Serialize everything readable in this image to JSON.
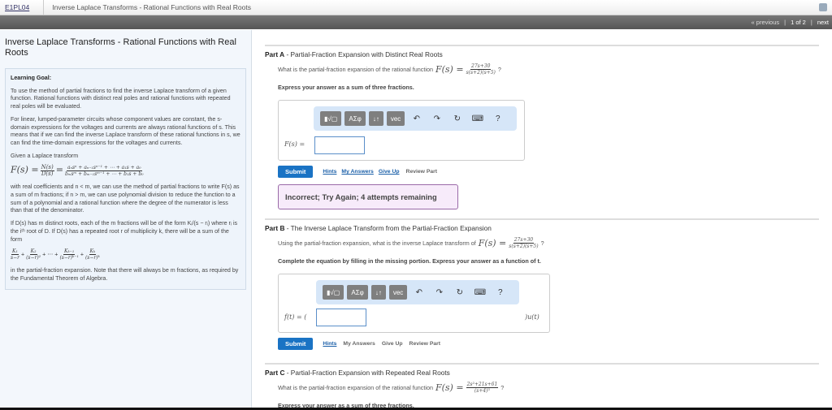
{
  "breadcrumb": {
    "code": "E1PL04",
    "title": "Inverse Laplace Transforms - Rational Functions with Real Roots"
  },
  "nav": {
    "previous": "« previous",
    "page": "1 of 2",
    "next": "next"
  },
  "left": {
    "title": "Inverse Laplace Transforms - Rational Functions with Real Roots",
    "goal_label": "Learning Goal:",
    "p1": "To use the method of partial fractions to find the inverse Laplace transform of a given function. Rational functions with distinct real poles and rational functions with repeated real poles will be evaluated.",
    "p2": "For linear, lumped-parameter circuits whose component values are constant, the s-domain expressions for the voltages and currents are always rational functions of s. This means that if we can find the inverse Laplace transform of these rational functions in s, we can find the time-domain expressions for the voltages and currents.",
    "p3": "Given a Laplace transform",
    "eq1": {
      "lhs": "F(s) =",
      "n": "N(s)",
      "d": "D(s)",
      "eq": "=",
      "num": "aₙsⁿ + aₙ₋₁sⁿ⁻¹ + ⋯ + a₁s + a₀",
      "den": "bₘsᵐ + bₘ₋₁sᵐ⁻¹ + ⋯ + b₁s + b₀"
    },
    "p4": "with real coefficients and n < m, we can use the method of partial fractions to write F(s) as a sum of m fractions; if n > m, we can use polynomial division to reduce the function to a sum of a polynomial and a rational function where the degree of the numerator is less than that of the denominator.",
    "p5": "If D(s) has m distinct roots, each of the m fractions will be of the form Kᵢ/(s − rᵢ) where rᵢ is the iᵗʰ root of D. If D(s) has a repeated root r of multiplicity k, there will be a sum of the form",
    "eq2": [
      {
        "n": "K₁",
        "d": "s−r"
      },
      {
        "n": "K₂",
        "d": "(s−r)²"
      },
      {
        "n": "Kₖ₋₁",
        "d": "(s−r)ᵏ⁻¹"
      },
      {
        "n": "Kₖ",
        "d": "(s−r)ᵏ"
      }
    ],
    "eq2_dots": "+ ⋯ +",
    "p6": "in the partial-fraction expansion. Note that there will always be m fractions, as required by the Fundamental Theorem of Algebra."
  },
  "toolbar": {
    "templates": "▮√▢",
    "greek": "ΑΣφ",
    "arrows": "↓↑",
    "vec": "vec",
    "undo": "↶",
    "redo": "↷",
    "reset": "↻",
    "keyboard": "⌨",
    "help": "?"
  },
  "partA": {
    "label": "Part A",
    "title": " - Partial-Fraction Expansion with Distinct Real Roots",
    "question": "What is the partial-fraction expansion of the rational function",
    "fs": "F(s) =",
    "num": "27s+30",
    "den": "s(s+2)(s+5)",
    "qmark": "?",
    "instr": "Express your answer as a sum of three fractions.",
    "input_label": "F(s) =",
    "input_value": "",
    "submit": "Submit",
    "hints": "Hints",
    "my_answers": "My Answers",
    "give_up": "Give Up",
    "review": "Review Part",
    "feedback": "Incorrect; Try Again; 4 attempts remaining"
  },
  "partB": {
    "label": "Part B",
    "title": " - The Inverse Laplace Transform from the Partial-Fraction Expansion",
    "question": "Using the partial-fraction expansion, what is the inverse Laplace transform of",
    "fs": "F(s) =",
    "num": "27s+30",
    "den": "s(s+2)(s+5)",
    "qmark": "?",
    "instr": "Complete the equation by filling in the missing portion. Express your answer as a function of t.",
    "input_label": "f(t) = (",
    "input_suffix": ")u(t)",
    "input_value": "",
    "submit": "Submit",
    "hints": "Hints",
    "my_answers": "My Answers",
    "give_up": "Give Up",
    "review": "Review Part"
  },
  "partC": {
    "label": "Part C",
    "title": " - Partial-Fraction Expansion with Repeated Real Roots",
    "question": "What is the partial-fraction expansion of the rational function",
    "fs": "F(s) =",
    "num": "2s²+21s+61",
    "den": "(s+4)³",
    "qmark": "?",
    "instr": "Express your answer as a sum of three fractions."
  }
}
